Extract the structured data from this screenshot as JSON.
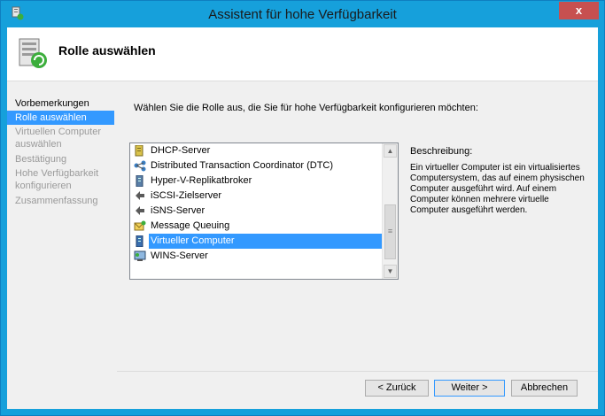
{
  "window": {
    "title": "Assistent für hohe Verfügbarkeit",
    "close_label": "x"
  },
  "header": {
    "title": "Rolle auswählen",
    "icon": "role-wizard-icon"
  },
  "steps": [
    {
      "label": "Vorbemerkungen",
      "state": "done"
    },
    {
      "label": "Rolle auswählen",
      "state": "active"
    },
    {
      "label": "Virtuellen Computer auswählen",
      "state": "pending"
    },
    {
      "label": "Bestätigung",
      "state": "pending"
    },
    {
      "label": "Hohe Verfügbarkeit konfigurieren",
      "state": "pending"
    },
    {
      "label": "Zusammenfassung",
      "state": "pending"
    }
  ],
  "instruction": "Wählen Sie die Rolle aus, die Sie für hohe Verfügbarkeit konfigurieren möchten:",
  "roles": [
    {
      "label": "DHCP-Server",
      "icon": "dhcp-icon"
    },
    {
      "label": "Distributed Transaction Coordinator (DTC)",
      "icon": "dtc-icon"
    },
    {
      "label": "Hyper-V-Replikatbroker",
      "icon": "server-icon"
    },
    {
      "label": "iSCSI-Zielserver",
      "icon": "iscsi-icon"
    },
    {
      "label": "iSNS-Server",
      "icon": "isns-icon"
    },
    {
      "label": "Message Queuing",
      "icon": "message-queuing-icon"
    },
    {
      "label": "Virtueller Computer",
      "icon": "virtual-machine-icon",
      "selected": true
    },
    {
      "label": "WINS-Server",
      "icon": "wins-icon"
    }
  ],
  "description": {
    "label": "Beschreibung:",
    "text": "Ein virtueller Computer ist ein virtualisiertes Computersystem, das auf einem physischen Computer ausgeführt wird. Auf einem Computer können mehrere virtuelle Computer ausgeführt werden."
  },
  "buttons": {
    "back": "< Zurück",
    "next": "Weiter >",
    "cancel": "Abbrechen"
  },
  "colors": {
    "titlebar": "#16a0db",
    "selection": "#3399ff",
    "close": "#c75050"
  }
}
